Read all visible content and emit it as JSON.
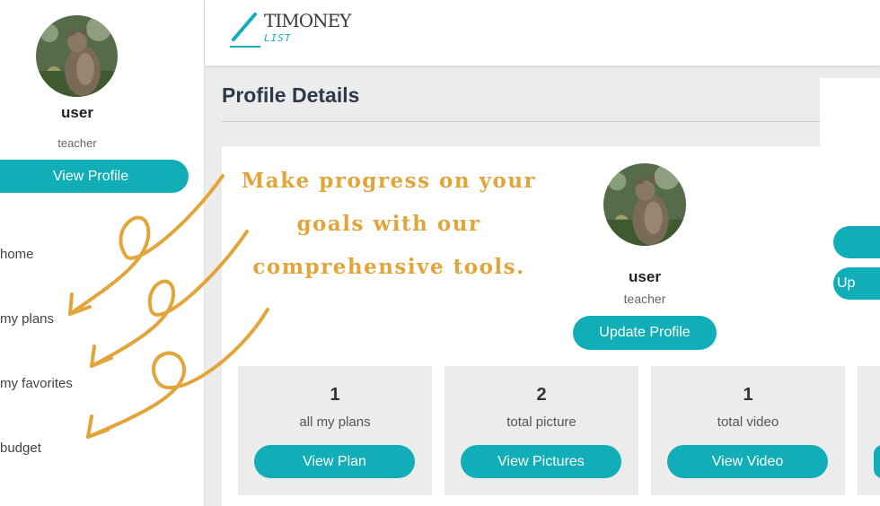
{
  "sidebar": {
    "user_name": "user",
    "user_role": "teacher",
    "view_profile_label": "View Profile",
    "nav": [
      {
        "label": "home"
      },
      {
        "label": "my plans"
      },
      {
        "label": "my favorites"
      },
      {
        "label": "budget"
      }
    ]
  },
  "header": {
    "logo_title": "TIMONEY",
    "logo_sub": "LIST"
  },
  "main": {
    "page_title": "Profile Details",
    "user_name": "user",
    "user_role": "teacher",
    "update_profile_label": "Update Profile",
    "right_button_partial": "Up",
    "stats": [
      {
        "count": "1",
        "label": "all my plans",
        "button": "View Plan"
      },
      {
        "count": "2",
        "label": "total picture",
        "button": "View Pictures"
      },
      {
        "count": "1",
        "label": "total video",
        "button": "View Video"
      }
    ]
  },
  "promo": {
    "lines": [
      "Make progress on your",
      "goals with our",
      "comprehensive tools."
    ]
  },
  "colors": {
    "accent": "#12aeb8",
    "promo": "#e1a53a",
    "title": "#2d3a4b"
  },
  "icons": [
    "avatar-cat-photo",
    "logo-pen-icon",
    "decorative-arrow-icon"
  ]
}
